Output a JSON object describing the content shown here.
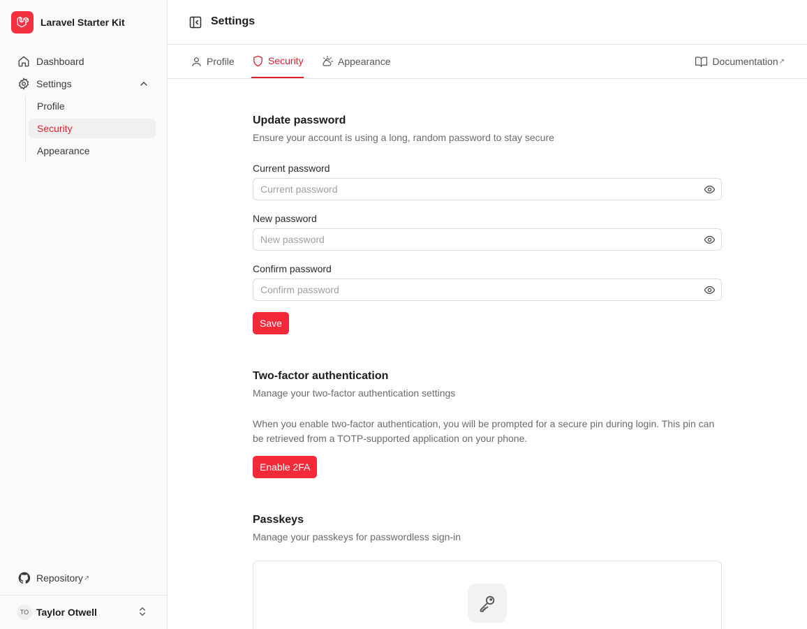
{
  "app": {
    "name": "Laravel Starter Kit"
  },
  "sidebar": {
    "items": [
      {
        "label": "Dashboard",
        "icon": "home-icon"
      },
      {
        "label": "Settings",
        "icon": "gear-icon",
        "expanded": true
      }
    ],
    "subitems": [
      {
        "label": "Profile"
      },
      {
        "label": "Security",
        "active": true
      },
      {
        "label": "Appearance"
      }
    ],
    "repository": "Repository",
    "user": {
      "initials": "TO",
      "name": "Taylor Otwell"
    }
  },
  "header": {
    "title": "Settings"
  },
  "tabs": [
    {
      "label": "Profile",
      "icon": "user-icon"
    },
    {
      "label": "Security",
      "icon": "shield-icon",
      "active": true
    },
    {
      "label": "Appearance",
      "icon": "sun-cloud-icon"
    }
  ],
  "docs_link": "Documentation",
  "password": {
    "title": "Update password",
    "description": "Ensure your account is using a long, random password to stay secure",
    "fields": [
      {
        "label": "Current password",
        "placeholder": "Current password",
        "value": ""
      },
      {
        "label": "New password",
        "placeholder": "New password",
        "value": ""
      },
      {
        "label": "Confirm password",
        "placeholder": "Confirm password",
        "value": ""
      }
    ],
    "save_label": "Save"
  },
  "twofa": {
    "title": "Two-factor authentication",
    "description": "Manage your two-factor authentication settings",
    "info": "When you enable two-factor authentication, you will be prompted for a secure pin during login. This pin can be retrieved from a TOTP-supported application on your phone.",
    "button_label": "Enable 2FA"
  },
  "passkeys": {
    "title": "Passkeys",
    "description": "Manage your passkeys for passwordless sign-in"
  },
  "colors": {
    "accent": "#f42a3a",
    "accent_text": "#e0202f"
  }
}
